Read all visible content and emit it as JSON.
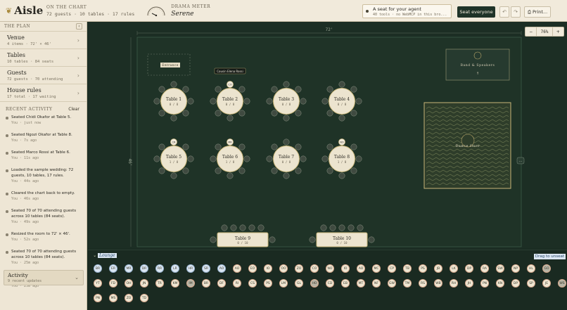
{
  "header": {
    "logo": "Aisle",
    "chart_label": "On the chart",
    "chart_stats": "72 guests · 10 tables · 17 rules",
    "drama_label": "Drama meter",
    "drama_value": "Serene",
    "agent_title": "A seat for your agent",
    "agent_sub": "40 tools · no WebMCP in this bro...",
    "seat_button": "Seat everyone",
    "print_button": "Print...",
    "undo_icon": "undo-icon",
    "redo_icon": "redo-icon"
  },
  "sidebar": {
    "plan_title": "The plan",
    "sections": [
      {
        "name": "Venue",
        "sub": "4 items · 72' × 46'"
      },
      {
        "name": "Tables",
        "sub": "10 tables · 84 seats"
      },
      {
        "name": "Guests",
        "sub": "72 guests · 70 attending"
      },
      {
        "name": "House rules",
        "sub": "17 total · 17 waiting"
      }
    ],
    "recent_title": "Recent activity",
    "clear": "Clear",
    "activity": [
      {
        "text": "Seated Chidi Okafor at Table 5.",
        "meta": "You · just now"
      },
      {
        "text": "Seated Ngozi Okafor at Table 8.",
        "meta": "You · 7s ago"
      },
      {
        "text": "Seated Marco Rossi at Table 6.",
        "meta": "You · 11s ago"
      },
      {
        "text": "Loaded the sample wedding: 72 guests, 10 tables, 17 rules.",
        "meta": "You · 44s ago"
      },
      {
        "text": "Cleared the chart back to empty.",
        "meta": "You · 46s ago"
      },
      {
        "text": "Seated 70 of 70 attending guests across 10 tables (84 seats).",
        "meta": "You · 49s ago"
      },
      {
        "text": "Resized the room to 72' × 46'.",
        "meta": "You · 52s ago"
      },
      {
        "text": "Seated 70 of 70 attending guests across 10 tables (84 seats).",
        "meta": "You · 25m ago"
      },
      {
        "text": "Loaded the sample wedding: 72 guests, 10 tables, 17 rules.",
        "meta": "You · 25m ago"
      }
    ],
    "activity_panel": {
      "name": "Activity",
      "sub": "9 recent updates"
    }
  },
  "canvas": {
    "room_width": "72'",
    "room_height": "46'",
    "entrance": "Entrance",
    "band": "Band & Speakers",
    "dance": "Dance floor",
    "tooltip": "Cousin Elena Rossi",
    "zoom_minus": "−",
    "zoom_value": "76%",
    "zoom_plus": "+",
    "tables": [
      {
        "name": "Table 1",
        "count": "0 / 8"
      },
      {
        "name": "Table 2",
        "count": "0 / 8"
      },
      {
        "name": "Table 3",
        "count": "0 / 8"
      },
      {
        "name": "Table 4",
        "count": "0 / 8"
      },
      {
        "name": "Table 5",
        "count": "1 / 8"
      },
      {
        "name": "Table 6",
        "count": "1 / 8"
      },
      {
        "name": "Table 7",
        "count": "0 / 8"
      },
      {
        "name": "Table 8",
        "count": "1 / 8"
      },
      {
        "name": "Table 9",
        "count": "0 / 10"
      },
      {
        "name": "Table 10",
        "count": "0 / 10"
      }
    ],
    "seated_badges": [
      "CR",
      "CO",
      "MR",
      "NO"
    ]
  },
  "tray": {
    "label": "Lounge",
    "hint": "Drag to unseat",
    "guests": [
      "BR",
      "ER",
      "MR",
      "DR",
      "RR",
      "LR",
      "HR",
      "SR",
      "AO",
      "AO",
      "EO",
      "IO",
      "OO",
      "ZO",
      "CO",
      "NO",
      "IO",
      "AO",
      "MC",
      "CP",
      "TB",
      "PS",
      "JB",
      "LK",
      "DP",
      "RA",
      "SW",
      "NP",
      "HL",
      "GO",
      "YT",
      "FD",
      "OH",
      "JN",
      "TR",
      "KM",
      "IM",
      "BR",
      "DF",
      "RI",
      "CS",
      "PS",
      "LM",
      "GL",
      "HO",
      "CD",
      "EB",
      "MT",
      "NF",
      "GW",
      "TM",
      "RS",
      "WB",
      "RH",
      "JH",
      "PN",
      "KN",
      "DP",
      "SP",
      "JE",
      "WS",
      "PN",
      "MS",
      "ZO",
      "TD"
    ]
  }
}
